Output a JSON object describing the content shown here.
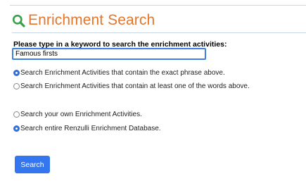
{
  "header": {
    "title": "Enrichment Search",
    "icon": "search-icon",
    "title_color": "#e1772e",
    "icon_color": "#3aa14a"
  },
  "search_form": {
    "prompt": "Please type in a keyword to search the enrichment activities:",
    "keyword_value": "Famous firsts",
    "match_options": [
      {
        "label": "Search Enrichment Activities that contain the exact phrase above.",
        "checked": true
      },
      {
        "label": "Search Enrichment Activities that contain at least one of the words above.",
        "checked": false
      }
    ],
    "scope_options": [
      {
        "label": "Search your own Enrichment Activities.",
        "checked": false
      },
      {
        "label": "Search entire Renzulli Enrichment Database.",
        "checked": true
      }
    ],
    "submit_label": "Search",
    "accent_color": "#3476f0"
  }
}
